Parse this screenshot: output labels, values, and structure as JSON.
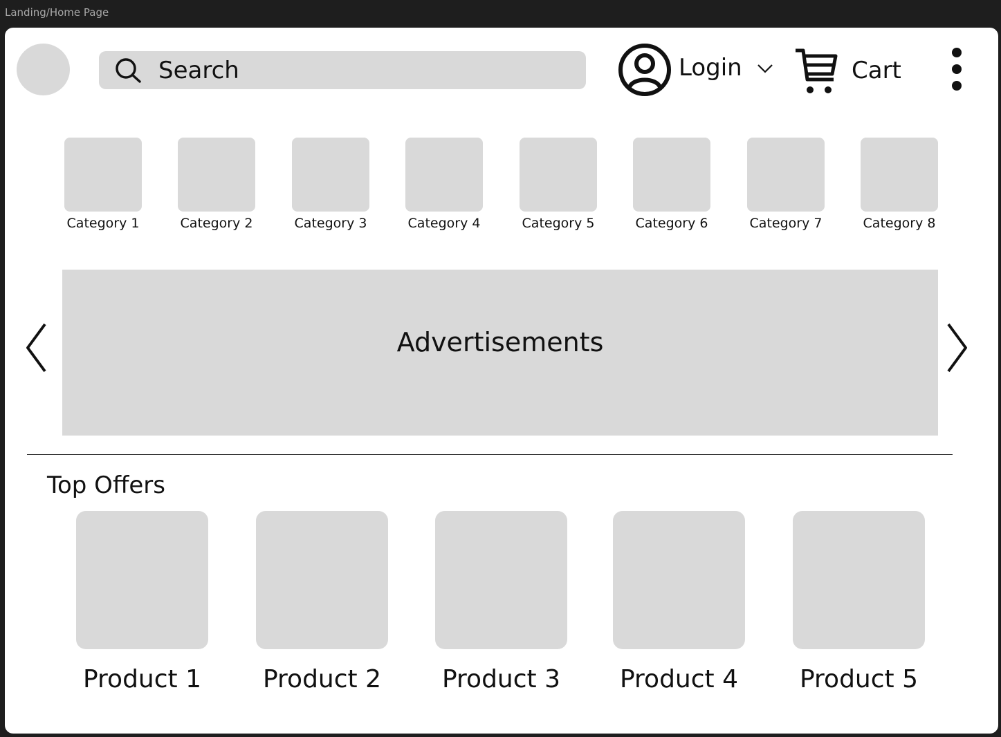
{
  "frame_title": "Landing/Home Page",
  "header": {
    "search_placeholder": "Search",
    "login_label": "Login",
    "cart_label": "Cart",
    "icons": [
      "search-icon",
      "user-circle-icon",
      "chevron-down-icon",
      "cart-icon",
      "more-vertical-icon"
    ]
  },
  "categories": [
    {
      "label": "Category 1"
    },
    {
      "label": "Category 2"
    },
    {
      "label": "Category 3"
    },
    {
      "label": "Category 4"
    },
    {
      "label": "Category 5"
    },
    {
      "label": "Category 6"
    },
    {
      "label": "Category 7"
    },
    {
      "label": "Category 8"
    }
  ],
  "banner": {
    "label": "Advertisements"
  },
  "top_offers": {
    "title": "Top Offers",
    "products": [
      {
        "label": "Product 1"
      },
      {
        "label": "Product 2"
      },
      {
        "label": "Product 3"
      },
      {
        "label": "Product 4"
      },
      {
        "label": "Product 5"
      }
    ]
  },
  "colors": {
    "canvas": "#1e1e1e",
    "page": "#ffffff",
    "placeholder": "#d9d9d9",
    "text": "#111111"
  }
}
